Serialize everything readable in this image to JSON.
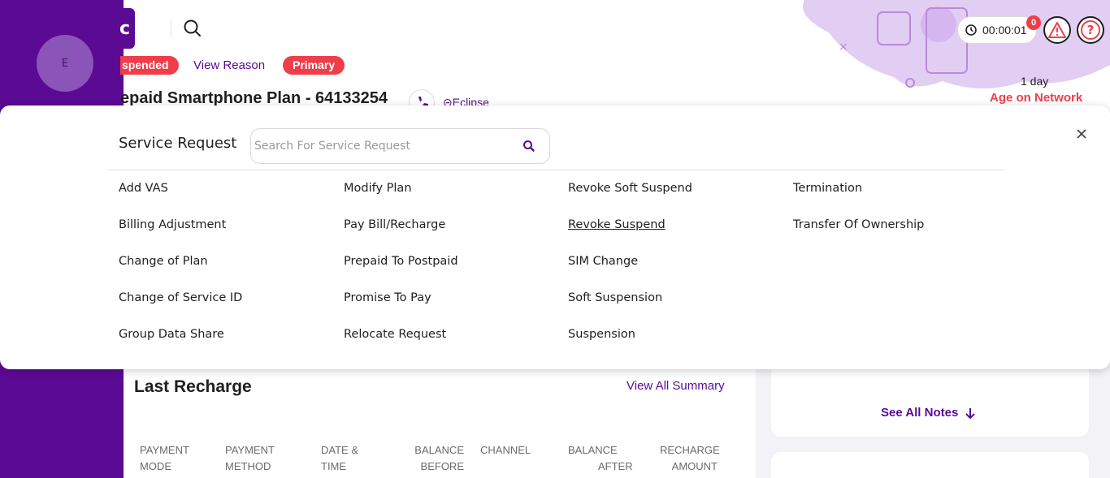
{
  "profile": {
    "avatar_initial": "E"
  },
  "header": {
    "status_badge": "spended",
    "view_reason": "View Reason",
    "primary_badge": "Primary",
    "plan_title": "epaid Smartphone Plan - 64133254",
    "account_link": "Eclipse",
    "timer": "00:00:01",
    "notification_count": "0",
    "age_on_network_value": "1 day",
    "age_on_network_label": "Age on Network"
  },
  "modal": {
    "title": "Service Request",
    "search_placeholder": "Search For Service Request",
    "columns": [
      [
        "Add VAS",
        "Billing Adjustment",
        "Change of Plan",
        "Change of Service ID",
        "Group Data Share"
      ],
      [
        "Modify Plan",
        "Pay Bill/Recharge",
        "Prepaid To Postpaid",
        "Promise To Pay",
        "Relocate Request"
      ],
      [
        "Revoke Soft Suspend",
        "Revoke Suspend",
        "SIM Change",
        "Soft Suspension",
        "Suspension"
      ],
      [
        "Termination",
        "Transfer Of Ownership"
      ]
    ],
    "hovered_item": "Revoke Suspend"
  },
  "last_recharge": {
    "title": "Last Recharge",
    "view_all": "View All Summary",
    "columns": [
      [
        "PAYMENT",
        "MODE"
      ],
      [
        "PAYMENT",
        "METHOD"
      ],
      [
        "DATE &",
        "TIME"
      ],
      [
        "BALANCE",
        "BEFORE"
      ],
      [
        "CHANNEL",
        ""
      ],
      [
        "BALANCE",
        "AFTER"
      ],
      [
        "RECHARGE",
        "AMOUNT"
      ]
    ]
  },
  "notes": {
    "see_all": "See All Notes"
  },
  "colors": {
    "brand_purple": "#5b0a93",
    "alert_red": "#ef3e4a"
  }
}
